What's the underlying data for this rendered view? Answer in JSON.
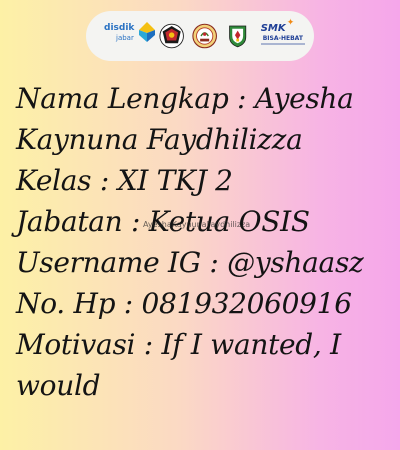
{
  "header": {
    "logos": [
      {
        "name": "disdik-jabar-logo",
        "text": "disdik",
        "sub": "jabar"
      },
      {
        "name": "school-seal-logo"
      },
      {
        "name": "regional-emblem-logo"
      },
      {
        "name": "west-java-emblem-logo"
      },
      {
        "name": "smk-bisa-hebat-logo",
        "text": "SMK",
        "sub": "BISA-HEBAT"
      }
    ]
  },
  "profile": {
    "lines": [
      "Nama Lengkap : Ayesha",
      "Kaynuna Faydhilizza",
      "Kelas : XI TKJ 2",
      "Jabatan : Ketua OSIS",
      "Username IG : @yshaasz",
      "No. Hp : 081932060916",
      "Motivasi : If I wanted, I",
      "would"
    ]
  },
  "watermark": "AyeshaKaynunaFaydhilizza",
  "colors": {
    "background_left": "#fdf1a6",
    "background_right": "#f5a6ea",
    "text": "#141414",
    "logo_bar": "#f4f4f2",
    "disdik_blue": "#2a72c3",
    "smk_blue": "#1f3f96"
  }
}
